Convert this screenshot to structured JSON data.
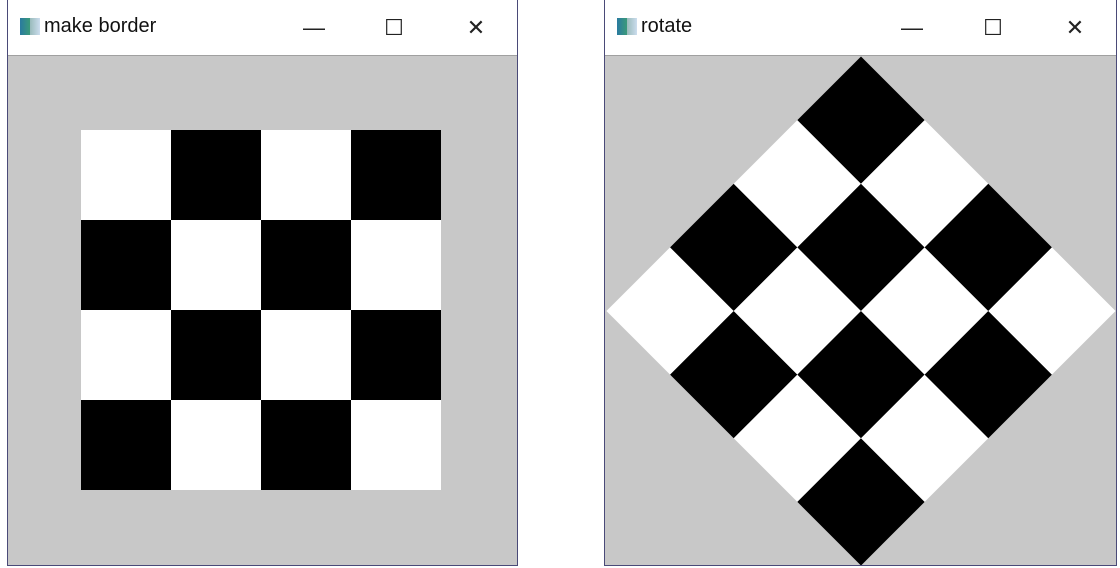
{
  "windows": [
    {
      "title": "make border",
      "icon": "opencv-window-icon",
      "controls": {
        "minimize": "—",
        "maximize": "☐",
        "close": "✕"
      }
    },
    {
      "title": "rotate",
      "icon": "opencv-window-icon",
      "controls": {
        "minimize": "—",
        "maximize": "☐",
        "close": "✕"
      }
    }
  ],
  "image": {
    "rows": 4,
    "cols": 4,
    "first_cell": "white",
    "rotation_degrees": 45,
    "colors": {
      "background": "#c8c8c8",
      "light": "#ffffff",
      "dark": "#000000"
    }
  }
}
